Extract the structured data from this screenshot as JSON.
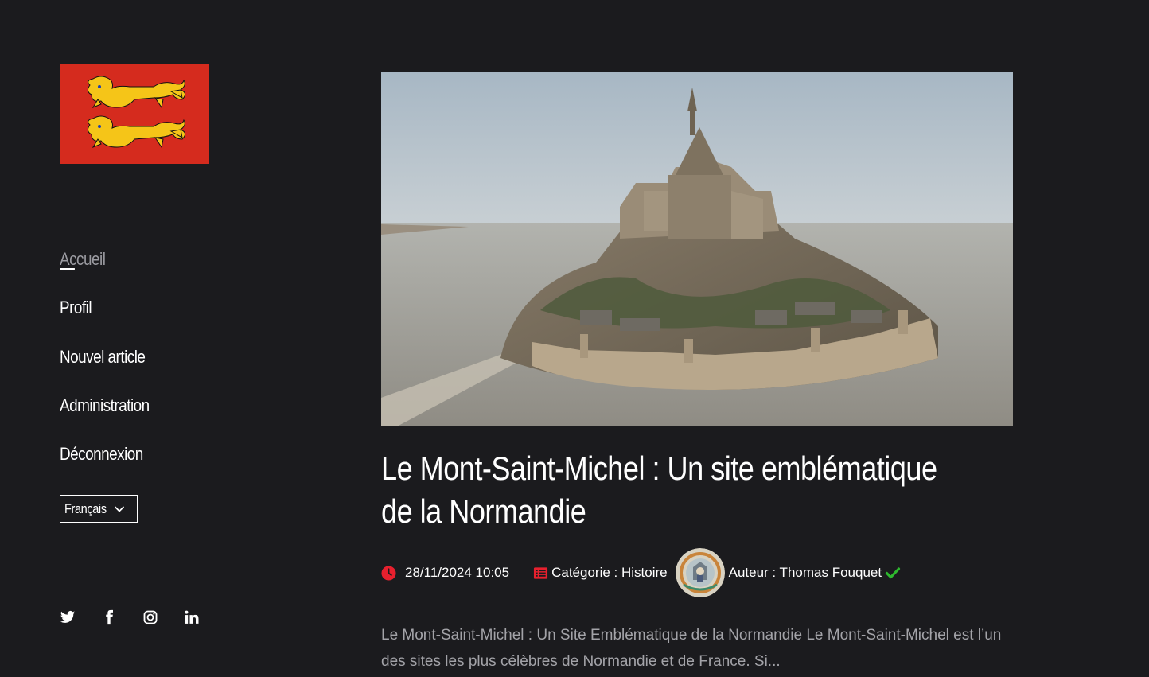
{
  "sidebar": {
    "logo": {
      "alt": "Drapeau de la Normandie",
      "colors": {
        "background": "#d52b1e",
        "lions": "#f5c518"
      }
    },
    "nav": {
      "items": [
        {
          "label": "Accueil",
          "active": true
        },
        {
          "label": "Profil"
        },
        {
          "label": "Nouvel article"
        },
        {
          "label": "Administration"
        },
        {
          "label": "Déconnexion"
        }
      ]
    },
    "language": {
      "selected": "Français",
      "icon": "chevron-down-icon"
    },
    "social": [
      "twitter-icon",
      "facebook-icon",
      "instagram-icon",
      "linkedin-icon"
    ]
  },
  "article": {
    "image_alt": "Le Mont-Saint-Michel",
    "title": "Le Mont-Saint-Michel : Un site emblématique de la Normandie",
    "date": "28/11/2024 10:05",
    "category": "Catégorie : Histoire",
    "author": "Auteur : Thomas Fouquet",
    "verified": true,
    "excerpt": "Le Mont-Saint-Michel : Un Site Emblématique de la Normandie Le Mont-Saint-Michel est l’un des sites les plus célèbres de Normandie et de France. Si..."
  },
  "colors": {
    "background": "#1b1b1e",
    "accent": "#e8202e",
    "verified": "#2eb82e",
    "muted_text": "#a3a3a8"
  }
}
